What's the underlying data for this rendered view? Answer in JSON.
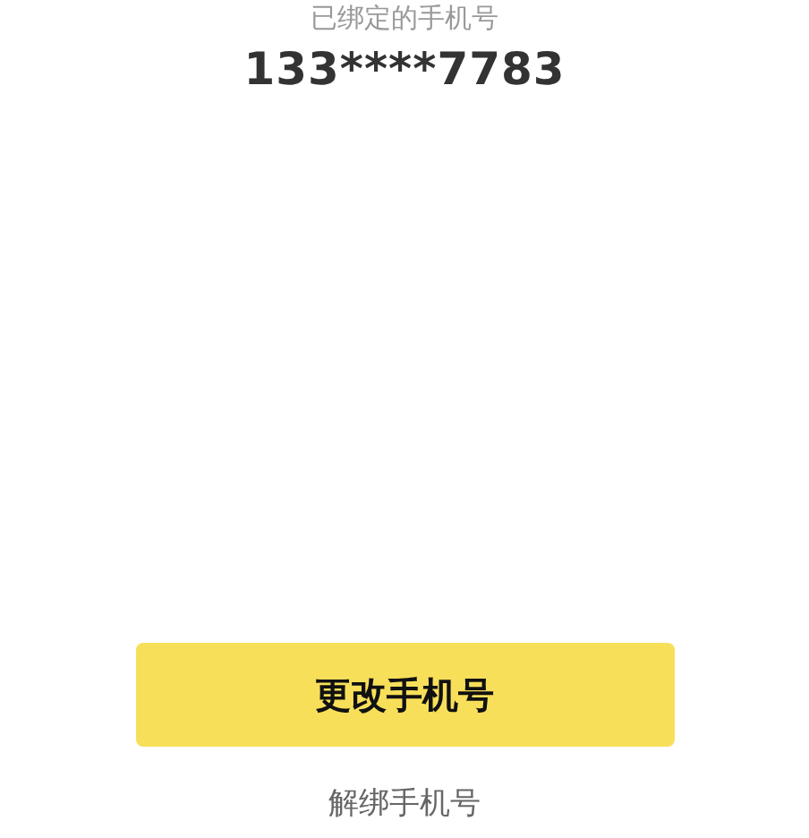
{
  "label": "已绑定的手机号",
  "phone": "133****7783",
  "primary_button": "更改手机号",
  "link": "解绑手机号"
}
